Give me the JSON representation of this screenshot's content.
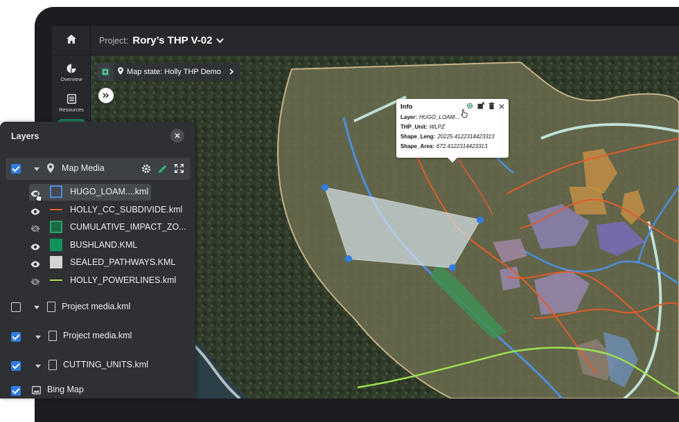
{
  "topbar": {
    "project_label": "Project:",
    "project_name": "Rory’s THP V-02"
  },
  "rail": {
    "overview_label": "Overview",
    "resources_label": "Resources"
  },
  "map_state": {
    "label": "Map state: Holly THP  Demo"
  },
  "info_popup": {
    "title": "Info",
    "rows": [
      {
        "key": "Layer:",
        "value": "HUGO_LOAM..."
      },
      {
        "key": "THP_Unit:",
        "value": "WLPZ"
      },
      {
        "key": "Shape_Leng:",
        "value": "20225.4122314423313"
      },
      {
        "key": "Shape_Area:",
        "value": "672.4122314423313"
      }
    ]
  },
  "layers": {
    "title": "Layers",
    "group": {
      "name": "Map Media",
      "checked": true
    },
    "sublayers": [
      {
        "name": "HUGO_LOAM....kml",
        "visible": true,
        "swatch": "outline-blue"
      },
      {
        "name": "HOLLY_CC_SUBDIVIDE.kml",
        "visible": true,
        "swatch": "line-orange"
      },
      {
        "name": "CUMULATIVE_IMPACT_ZO...",
        "visible": false,
        "swatch": "green-outline"
      },
      {
        "name": "BUSHLAND.KML",
        "visible": true,
        "swatch": "green-fill"
      },
      {
        "name": "SEALED_PATHWAYS.KML",
        "visible": true,
        "swatch": "grey-fill"
      },
      {
        "name": "HOLLY_POWERLINES.kml",
        "visible": false,
        "swatch": "line-yellowgreen"
      }
    ],
    "files": [
      {
        "name": "Project media.kml",
        "checked": false
      },
      {
        "name": "Project media.kml",
        "checked": true
      },
      {
        "name": "CUTTING_UNITS.kml",
        "checked": true
      }
    ],
    "basemap": {
      "name": "Bing Map",
      "checked": true
    }
  },
  "colors": {
    "accent": "#2f7de1",
    "green": "#1f7a55",
    "panel": "#2e3034"
  }
}
